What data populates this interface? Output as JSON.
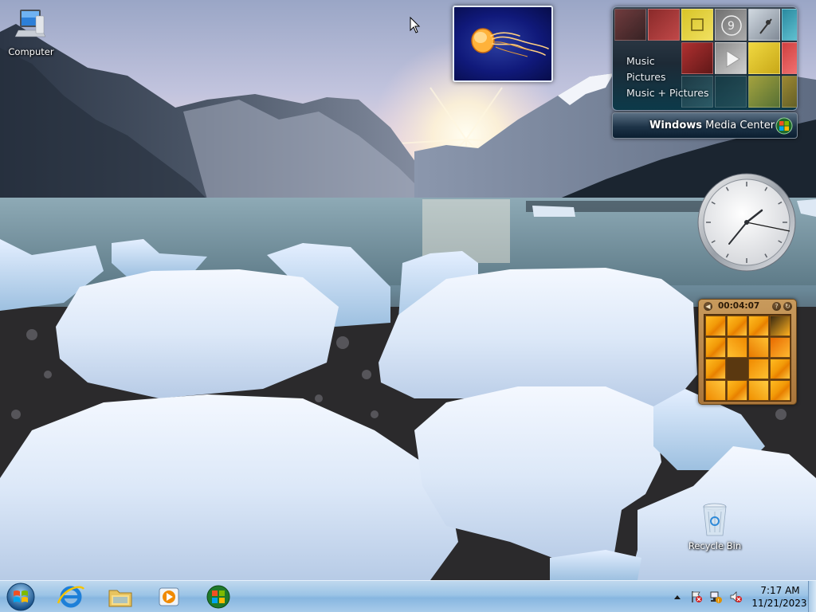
{
  "desktop": {
    "icons": [
      {
        "label": "Computer"
      },
      {
        "label": "Recycle Bin"
      }
    ]
  },
  "gadgets": {
    "media_center": {
      "menu": [
        "Music",
        "Pictures",
        "Music + Pictures"
      ],
      "title_bold": "Windows",
      "title_rest": " Media Center"
    },
    "puzzle": {
      "timer": "00:04:07"
    }
  },
  "taskbar": {
    "time": "7:17 AM",
    "date": "11/21/2023",
    "pinned": [
      "internet-explorer-icon",
      "windows-explorer-icon",
      "windows-media-player-icon",
      "windows-media-center-icon"
    ]
  }
}
